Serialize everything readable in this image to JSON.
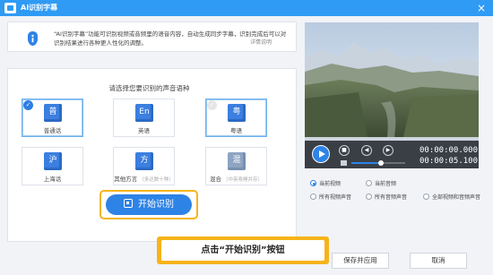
{
  "window": {
    "title": "AI识别字幕",
    "close_glyph": "×"
  },
  "notice": {
    "line1": "“AI识别字幕”功能可识别视频或音频里的语音内容，自动生成同步字幕，识别完成后可以对",
    "line2": "识别结果进行各种更人性化的调整。",
    "details_link": "详情说明"
  },
  "language_prompt": "请选择您要识别的声音语种",
  "languages": [
    {
      "glyph": "普",
      "label": "普通话",
      "hint": "",
      "selected": true,
      "badge": "✓"
    },
    {
      "glyph": "En",
      "label": "英语",
      "hint": "",
      "selected": false,
      "badge": ""
    },
    {
      "glyph": "粤",
      "label": "粤语",
      "hint": "",
      "selected": false,
      "badge": "✓"
    },
    {
      "glyph": "沪",
      "label": "上海话",
      "hint": "",
      "selected": false,
      "badge": ""
    },
    {
      "glyph": "方",
      "label": "其他方言",
      "hint": "（多达数十种）",
      "selected": false,
      "badge": ""
    },
    {
      "glyph": "混",
      "label": "混合",
      "hint": "（中英粤睡并存）",
      "selected": false,
      "badge": ""
    }
  ],
  "start_button": {
    "label": "开始识别"
  },
  "callout": {
    "text": "点击“开始识别”按钮"
  },
  "player": {
    "current_time": "00:00:00.000",
    "total_time": "00:00:05.100",
    "volume": 0.55,
    "controls": {
      "stop": "■",
      "prev": "◀",
      "next": "▶"
    }
  },
  "scope_options": [
    {
      "label": "当前视频",
      "checked": true
    },
    {
      "label": "当前音频",
      "checked": false
    },
    {
      "label": "所有视频声音",
      "checked": false
    },
    {
      "label": "所有音频声音",
      "checked": false
    },
    {
      "label": "全部视频和音频声音",
      "checked": false
    }
  ],
  "footer": {
    "save_label": "保存并应用",
    "cancel_label": "取消"
  },
  "colors": {
    "accent": "#2e83e6",
    "titlebar": "#2f9bf4",
    "highlight": "#f6b41a"
  }
}
